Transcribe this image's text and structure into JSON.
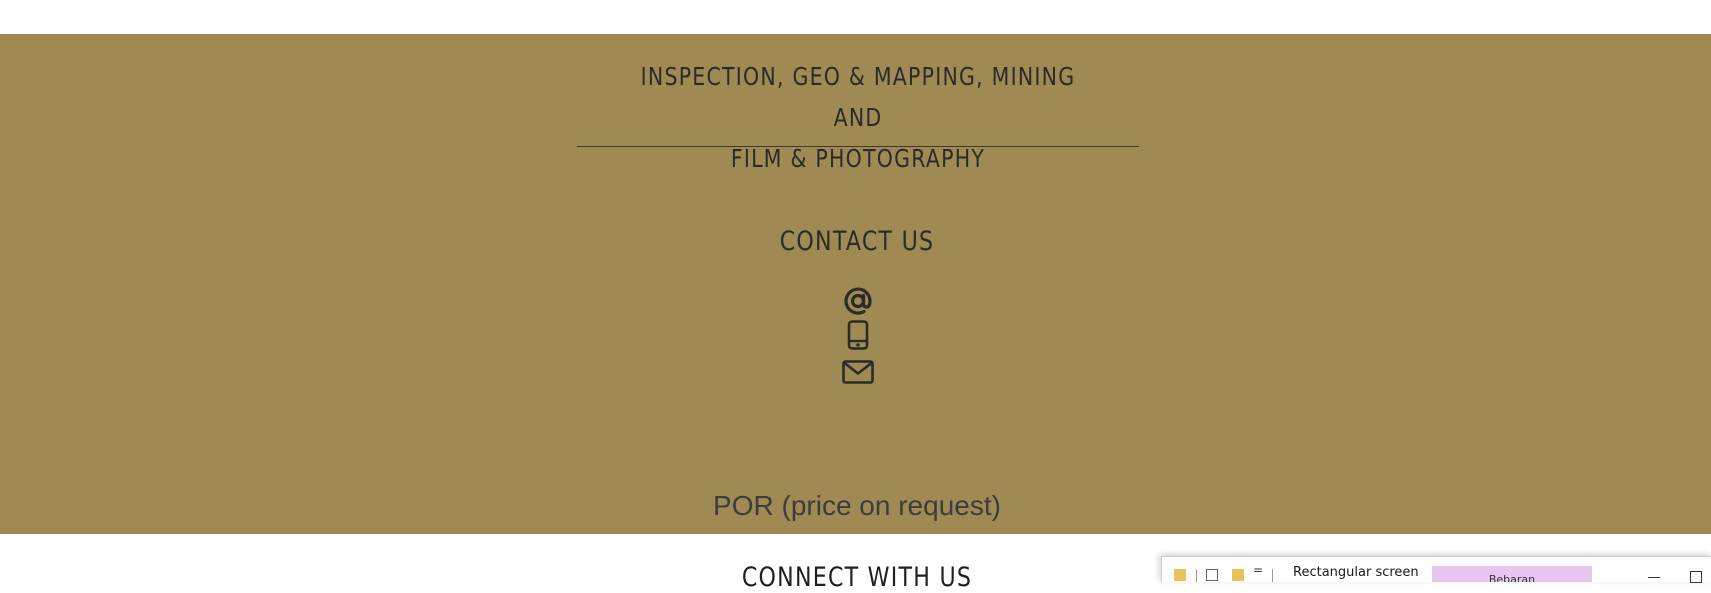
{
  "banner": {
    "heading_line1": "INSPECTION, GEO & MAPPING, MINING AND",
    "heading_line2": "FILM & PHOTOGRAPHY",
    "background_color": "#a08a53"
  },
  "contact": {
    "title": "CONTACT US",
    "icons": [
      "at-sign-icon",
      "mobile-phone-icon",
      "envelope-icon"
    ]
  },
  "pricing": {
    "text": "POR (price on request)"
  },
  "connect": {
    "title": "CONNECT WITH US"
  },
  "taskbar_window": {
    "title": "Rectangular screen",
    "highlight_label": "Bebaran",
    "menu_glyph": "="
  }
}
